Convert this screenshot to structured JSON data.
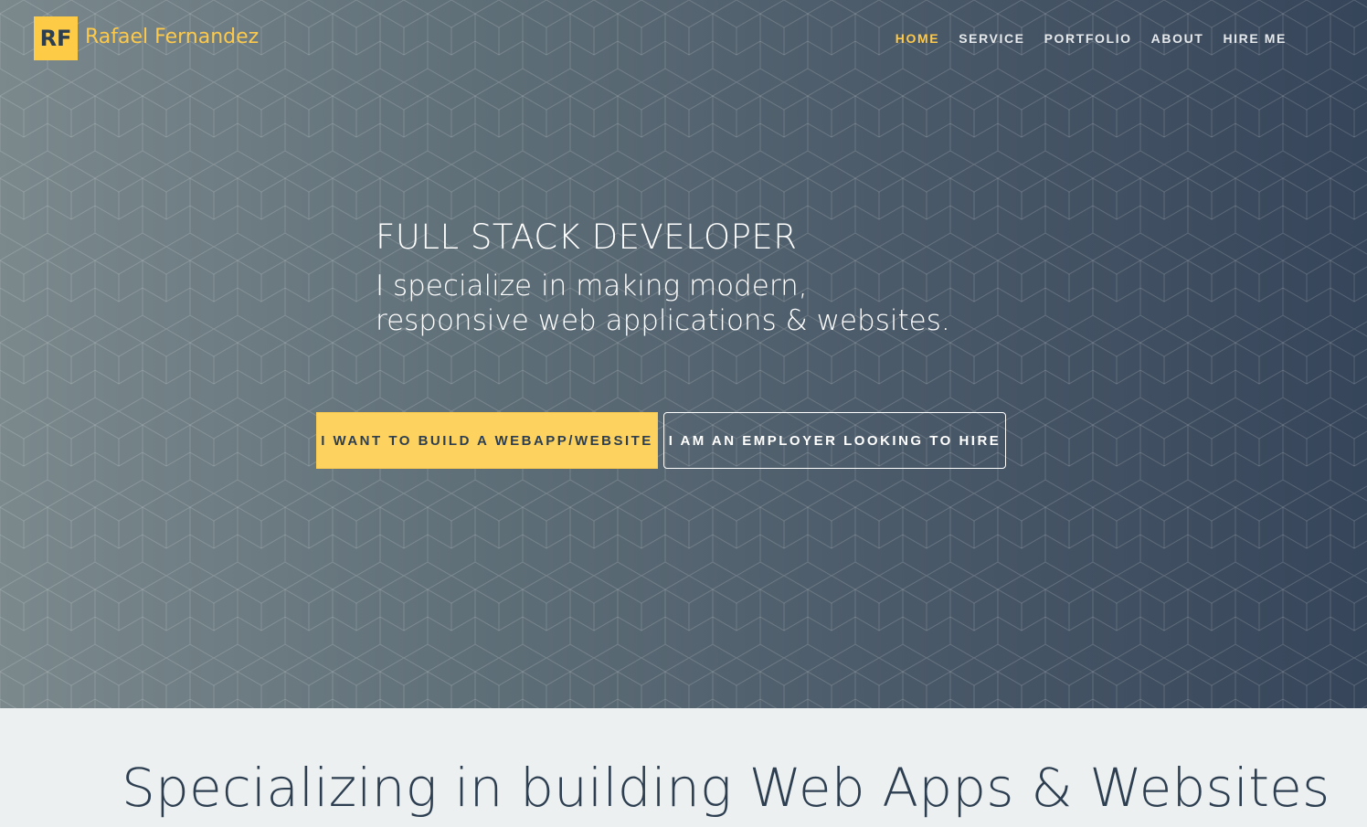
{
  "brand": {
    "logo": "RF",
    "name": "Rafael Fernandez"
  },
  "nav": {
    "items": [
      {
        "label": "HOME",
        "active": true
      },
      {
        "label": "SERVICE",
        "active": false
      },
      {
        "label": "PORTFOLIO",
        "active": false
      },
      {
        "label": "ABOUT",
        "active": false
      },
      {
        "label": "HIRE ME",
        "active": false
      }
    ]
  },
  "hero": {
    "title": "FULL STACK DEVELOPER",
    "subtitle_line1": "I specialize in making modern,",
    "subtitle_line2": "responsive web applications & websites.",
    "primary_button": "I WANT TO BUILD A WEBAPP/WEBSITE",
    "secondary_button": "I AM AN EMPLOYER LOOKING TO HIRE"
  },
  "section": {
    "title": "Specializing in building Web Apps & Websites"
  },
  "colors": {
    "accent": "#fec94a",
    "dark": "#2c3e50",
    "light_bg": "#ecf0f1"
  }
}
